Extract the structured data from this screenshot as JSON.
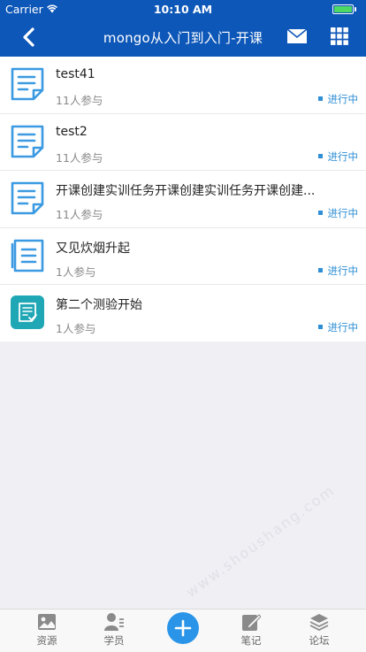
{
  "status_bar": {
    "carrier": "Carrier",
    "time": "10:10 AM"
  },
  "nav": {
    "title": "mongo从入门到入门-开课"
  },
  "items": [
    {
      "title": "test41",
      "count": "11人参与",
      "status": "进行中",
      "icon": "document-icon"
    },
    {
      "title": "test2",
      "count": "11人参与",
      "status": "进行中",
      "icon": "document-icon"
    },
    {
      "title": "开课创建实训任务开课创建实训任务开课创建...",
      "count": "11人参与",
      "status": "进行中",
      "icon": "document-icon"
    },
    {
      "title": "又见炊烟升起",
      "count": "1人参与",
      "status": "进行中",
      "icon": "list-doc-icon"
    },
    {
      "title": "第二个测验开始",
      "count": "1人参与",
      "status": "进行中",
      "icon": "quiz-icon"
    }
  ],
  "watermark": "www.shoushang.com",
  "tabbar": {
    "resources": "资源",
    "students": "学员",
    "notes": "笔记",
    "forum": "论坛"
  },
  "colors": {
    "header": "#0d57b8",
    "accent": "#2e8fd6",
    "quiz_icon": "#1fa7b5",
    "doc_icon": "#3b9ae1"
  }
}
